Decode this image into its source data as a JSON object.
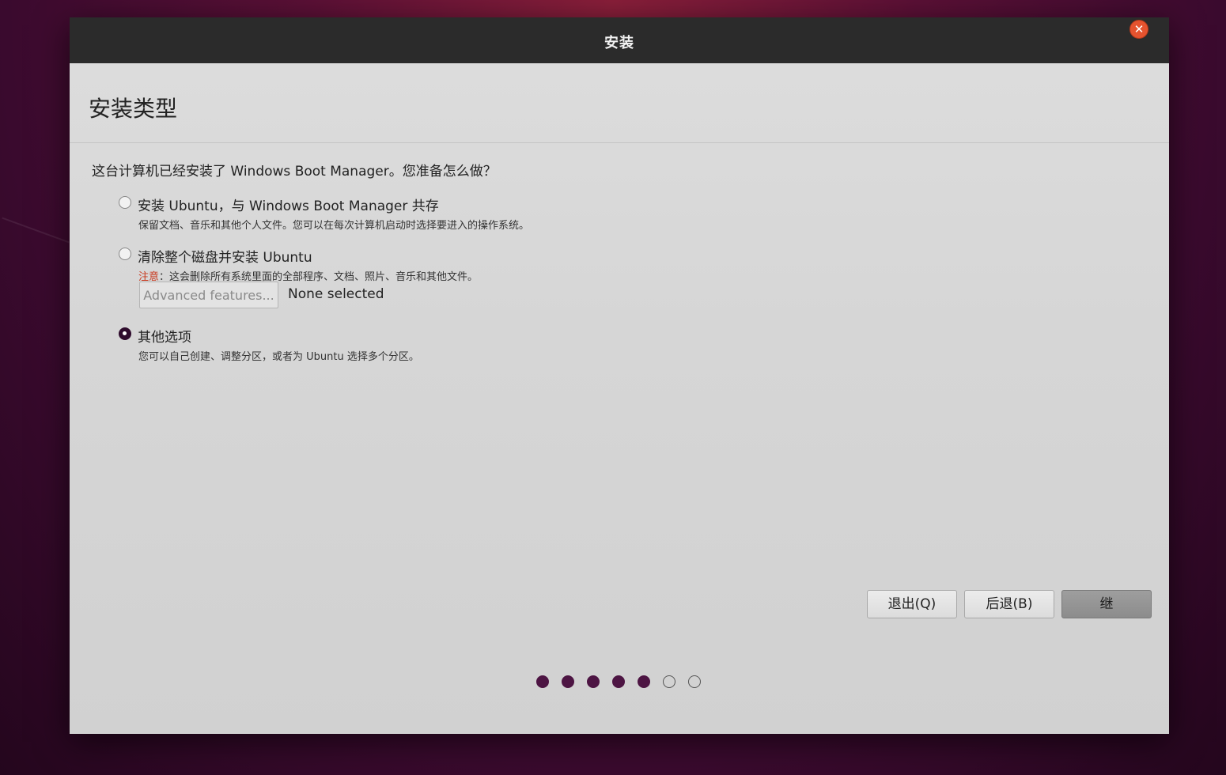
{
  "window": {
    "title": "安装"
  },
  "page": {
    "title": "安装类型"
  },
  "question": "这台计算机已经安装了 Windows Boot Manager。您准备怎么做？",
  "options": [
    {
      "label": "安装 Ubuntu，与 Windows Boot Manager 共存",
      "description": "保留文档、音乐和其他个人文件。您可以在每次计算机启动时选择要进入的操作系统。",
      "selected": false
    },
    {
      "label": "清除整个磁盘并安装 Ubuntu",
      "warning_prefix": "注意",
      "description": "：这会删除所有系统里面的全部程序、文档、照片、音乐和其他文件。",
      "selected": false
    },
    {
      "label": "其他选项",
      "description": "您可以自己创建、调整分区，或者为 Ubuntu 选择多个分区。",
      "selected": true
    }
  ],
  "advanced": {
    "button_label": "Advanced features...",
    "status": "None selected"
  },
  "buttons": {
    "quit": "退出(Q)",
    "back": "后退(B)",
    "continue": "继"
  },
  "progress": {
    "total_steps": 7,
    "completed_steps": 5
  },
  "colors": {
    "accent": "#4d1543",
    "warning": "#c8361b",
    "close": "#e5532f"
  }
}
